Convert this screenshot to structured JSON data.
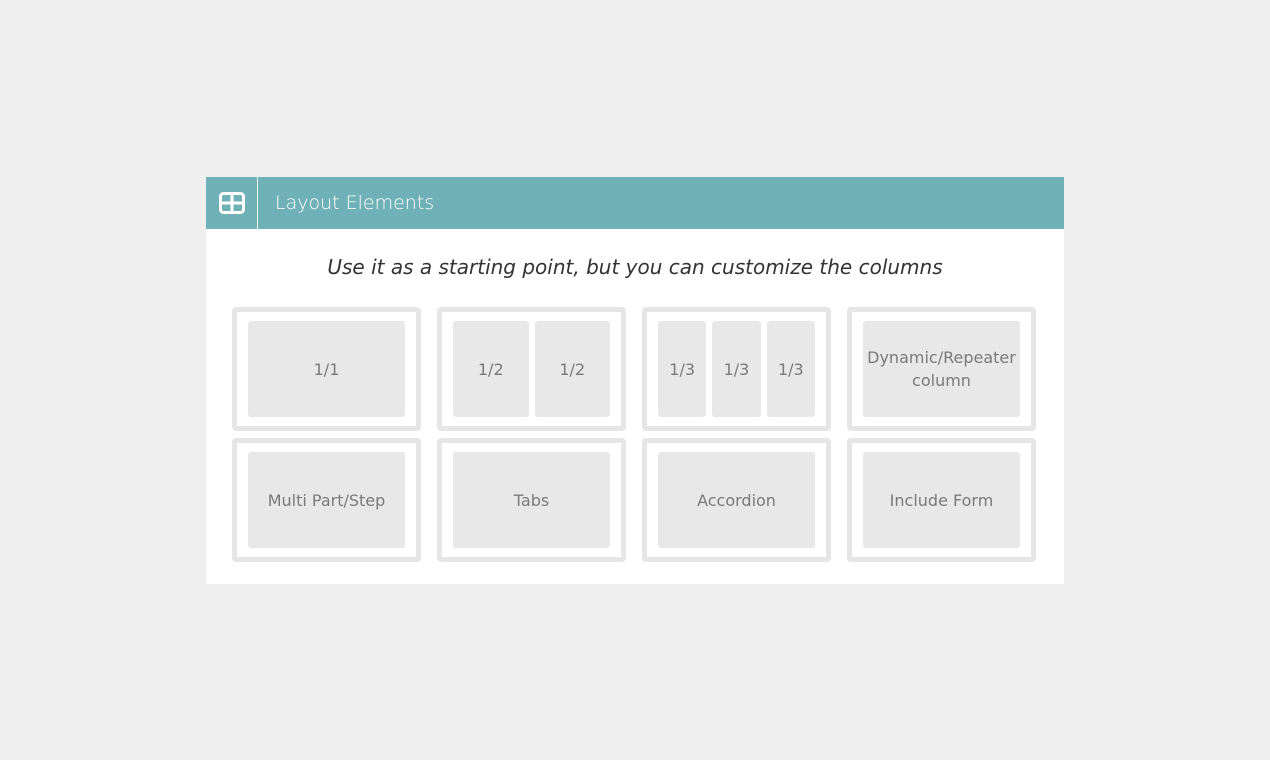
{
  "panel": {
    "title": "Layout Elements",
    "header_icon": "layout-grid-icon",
    "header_color": "#70b1b7",
    "subtitle": "Use it as a starting point, but you can customize the columns"
  },
  "tiles": [
    {
      "name": "one-column-layout",
      "columns": [
        "1/1"
      ]
    },
    {
      "name": "two-column-layout",
      "columns": [
        "1/2",
        "1/2"
      ]
    },
    {
      "name": "three-column-layout",
      "columns": [
        "1/3",
        "1/3",
        "1/3"
      ]
    },
    {
      "name": "dynamic-repeater-column",
      "columns": [
        "Dynamic/Repeater column"
      ]
    },
    {
      "name": "multi-part-step",
      "columns": [
        "Multi Part/Step"
      ]
    },
    {
      "name": "tabs",
      "columns": [
        "Tabs"
      ]
    },
    {
      "name": "accordion",
      "columns": [
        "Accordion"
      ]
    },
    {
      "name": "include-form",
      "columns": [
        "Include Form"
      ]
    }
  ]
}
